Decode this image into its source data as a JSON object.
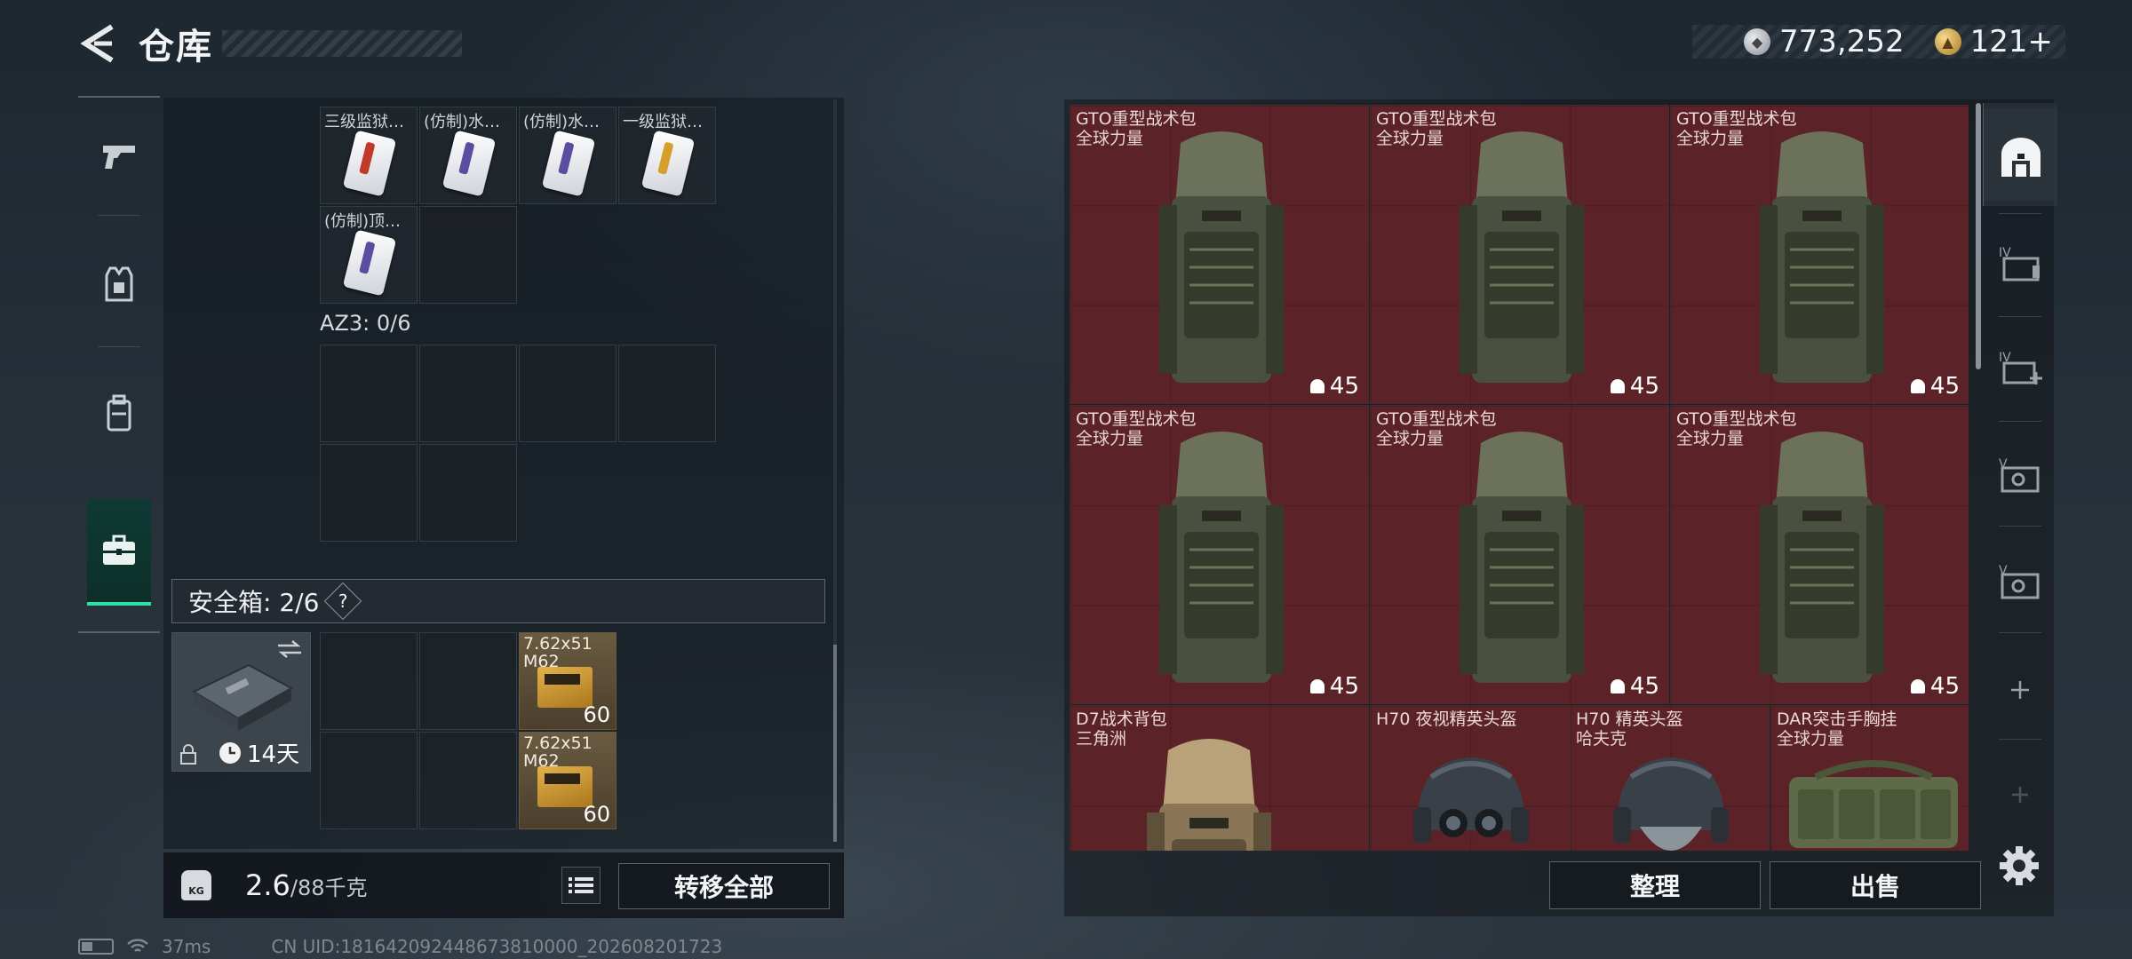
{
  "header": {
    "title": "仓库",
    "silver": "773,252",
    "gold": "121+"
  },
  "left_rail": {
    "items": [
      "weapon",
      "armor",
      "backpack",
      "case"
    ],
    "active": "case"
  },
  "top_grid": [
    {
      "label": "三级监狱…",
      "color": "#c0392b"
    },
    {
      "label": "(仿制)水…",
      "color": "#5b4da0"
    },
    {
      "label": "(仿制)水…",
      "color": "#5b4da0"
    },
    {
      "label": "一级监狱…",
      "color": "#d4a02a"
    },
    {
      "label": "(仿制)顶…",
      "color": "#5b4da0"
    }
  ],
  "az3": {
    "label": "AZ3: 0/6"
  },
  "safe": {
    "header": "安全箱: 2/6",
    "help": "?",
    "timer": "14天",
    "ammo": [
      {
        "name": "7.62x51 M62",
        "qty": "60"
      },
      {
        "name": "7.62x51 M62",
        "qty": "60"
      }
    ]
  },
  "weight": {
    "current": "2.6",
    "max": "/88千克",
    "transfer_label": "转移全部"
  },
  "status": {
    "ping": "37ms",
    "uid": "CN UID:181642092448673810000_202608201723"
  },
  "stash": {
    "items": [
      {
        "name": "GTO重型战术包",
        "region": "全球力量",
        "dur": "45",
        "kind": "pack"
      },
      {
        "name": "GTO重型战术包",
        "region": "全球力量",
        "dur": "45",
        "kind": "pack"
      },
      {
        "name": "GTO重型战术包",
        "region": "全球力量",
        "dur": "45",
        "kind": "pack"
      },
      {
        "name": "GTO重型战术包",
        "region": "全球力量",
        "dur": "45",
        "kind": "pack"
      },
      {
        "name": "GTO重型战术包",
        "region": "全球力量",
        "dur": "45",
        "kind": "pack"
      },
      {
        "name": "GTO重型战术包",
        "region": "全球力量",
        "dur": "45",
        "kind": "pack"
      },
      {
        "name": "D7战术背包",
        "region": "三角洲",
        "kind": "pack-tan"
      },
      {
        "name": "H70 夜视精英头盔",
        "region": "",
        "kind": "helmet-nv"
      },
      {
        "name": "H70 精英头盔",
        "region": "哈夫克",
        "kind": "helmet"
      },
      {
        "name": "DAR突击手胸挂",
        "region": "全球力量",
        "kind": "rig"
      }
    ],
    "sort_label": "整理",
    "sell_label": "出售"
  },
  "colors": {
    "accent": "#2fe1a8",
    "item_bg": "#5b2228",
    "ammo_bg": "#5a4a34"
  }
}
